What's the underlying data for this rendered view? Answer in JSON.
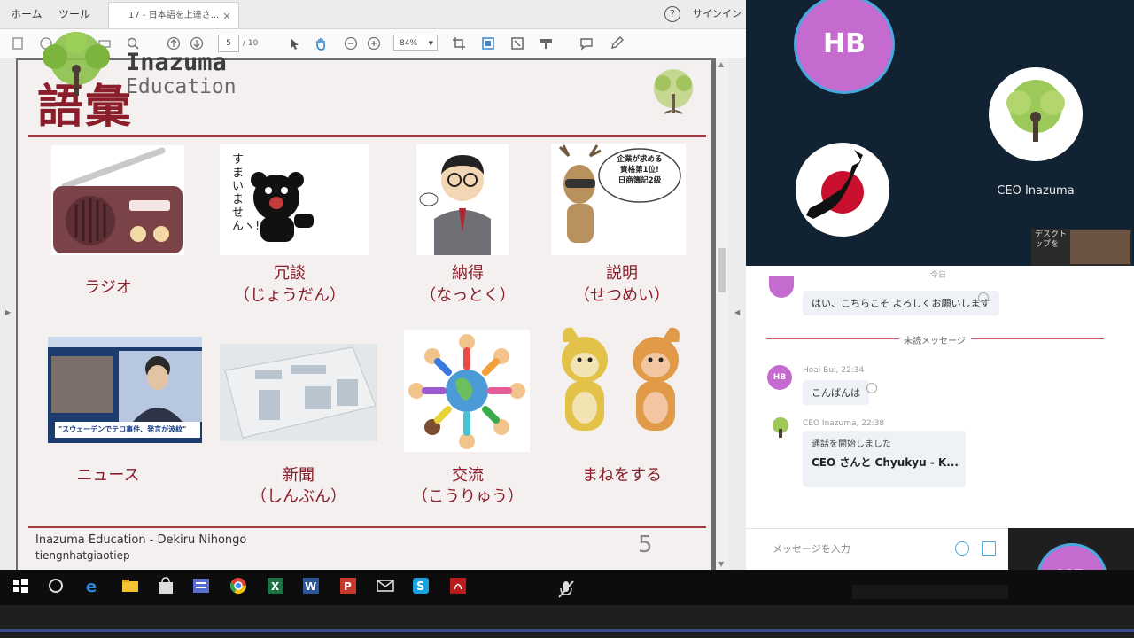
{
  "viewer": {
    "tabs": [
      "ホーム",
      "ツール"
    ],
    "doc_tab_label": "17 - 日本語を上達さ...",
    "doc_tab_close": "×",
    "help_icon_label": "?",
    "signin_label": "サインイン",
    "page_current": "5",
    "page_total": "/ 10",
    "zoom": "84%"
  },
  "watermark": {
    "line1": "Inazuma",
    "line2": "Education"
  },
  "slide": {
    "title": "語彙",
    "items": [
      {
        "label": "ラジオ",
        "reading": ""
      },
      {
        "label": "冗談",
        "reading": "（じょうだん）"
      },
      {
        "label": "納得",
        "reading": "（なっとく）"
      },
      {
        "label": "説明",
        "reading": "（せつめい）"
      },
      {
        "label": "ニュース",
        "reading": ""
      },
      {
        "label": "新聞",
        "reading": "（しんぶん）"
      },
      {
        "label": "交流",
        "reading": "（こうりゅう）"
      },
      {
        "label": "まねをする",
        "reading": ""
      }
    ],
    "bear_caption": "すまいませんヽ!",
    "bubble_caption": [
      "企業が求める",
      "資格第1位!",
      "日商簿記2級"
    ],
    "news_caption": "\"スウェーデンでテロ事件、発言が波紋\"",
    "footer_line1": "Inazuma Education - Dekiru Nihongo",
    "footer_line2": "tiengnhatgiaotiep",
    "page_number": "5"
  },
  "skype": {
    "self_initials": "HB",
    "ceo_name": "CEO Inazuma",
    "desktop_label": "デスクトップを",
    "date_separator": "今日",
    "messages": [
      {
        "text": "はい、こちらこそ よろしくお願いします"
      },
      {
        "sender": "Hoai Bui, 22:34",
        "initials": "HB",
        "text": "こんばんは"
      },
      {
        "sender": "CEO Inazuma, 22:38",
        "line1": "通話を開始しました",
        "line2": "CEO さんと Chyukyu - K..."
      }
    ],
    "unread_label": "未読メッセージ",
    "composer_placeholder": "メッセージを入力"
  },
  "colors": {
    "accent": "#8b1e2a",
    "skype_dark": "#112233",
    "avatar": "#c56bcf",
    "ring": "#4aa7df"
  }
}
